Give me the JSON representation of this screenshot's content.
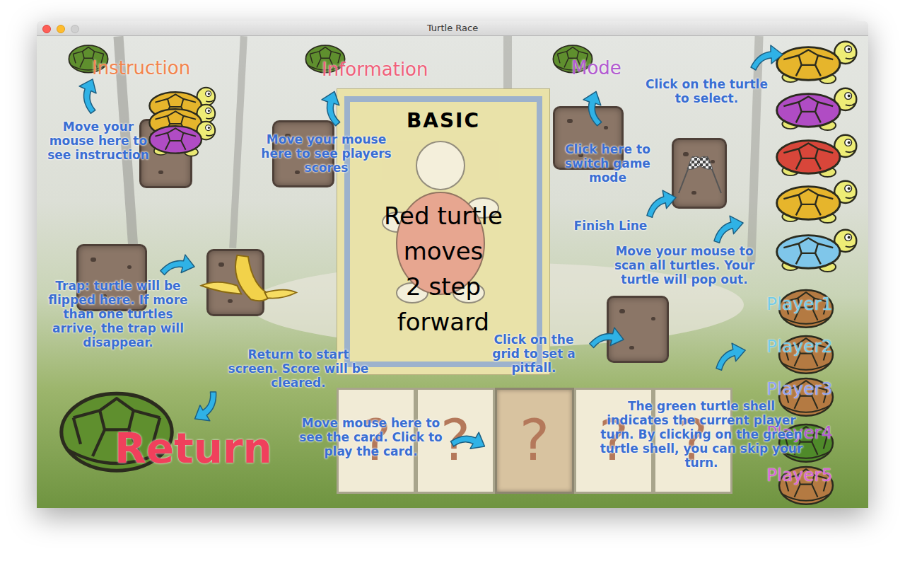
{
  "window": {
    "title": "Turtle Race"
  },
  "menu": [
    {
      "label": "Instruction",
      "color": "#f2844c"
    },
    {
      "label": "Information",
      "color": "#f0607a"
    },
    {
      "label": "Mode",
      "color": "#b25ad0"
    }
  ],
  "hints": [
    {
      "text": "Move your mouse here to see instruction"
    },
    {
      "text": "Move your mouse here to see players scores"
    },
    {
      "text": "Click on the turtle to select."
    },
    {
      "text": "Click here to switch game mode"
    },
    {
      "text": "Finish Line"
    },
    {
      "text": "Move your mouse to scan all turtles. Your turtle will pop out."
    },
    {
      "text": "Trap: turtle will be flipped here. If more than one turtles arrive, the trap will disappear."
    },
    {
      "text": "Return to start screen. Score will be cleared."
    },
    {
      "text": "Click on the grid to set a pitfall."
    },
    {
      "text": "Move mouse here to see the card. Click to play the card."
    },
    {
      "text": "The green turtle shell indicates the current player turn. By clicking on the green turtle shell, you can skip your turn."
    }
  ],
  "card": {
    "title": "BASIC",
    "lines": [
      "Red turtle",
      "moves",
      "2 step",
      "forward"
    ]
  },
  "hand": [
    {
      "label": "?",
      "selected": false
    },
    {
      "label": "?",
      "selected": false
    },
    {
      "label": "?",
      "selected": true
    },
    {
      "label": "?",
      "selected": false
    },
    {
      "label": "?",
      "selected": false
    }
  ],
  "turtles": [
    {
      "color": "#e6b52c"
    },
    {
      "color": "#b04cc4"
    },
    {
      "color": "#d8463a"
    },
    {
      "color": "#e6b52c"
    },
    {
      "color": "#7fc6ea"
    }
  ],
  "stack_turtles": [
    {
      "color": "#e6b52c"
    },
    {
      "color": "#e6b52c"
    },
    {
      "color": "#b04cc4"
    }
  ],
  "players": [
    {
      "name": "Player1",
      "current": false,
      "color": "#74cbe6"
    },
    {
      "name": "Player2",
      "current": false,
      "color": "#74cbe6"
    },
    {
      "name": "Player3",
      "current": false,
      "color": "#8ea2f2"
    },
    {
      "name": "Player4",
      "current": true,
      "color": "#b25ad0"
    },
    {
      "name": "Player5",
      "current": false,
      "color": "#d865d8"
    }
  ],
  "return_button": {
    "label": "Return"
  }
}
